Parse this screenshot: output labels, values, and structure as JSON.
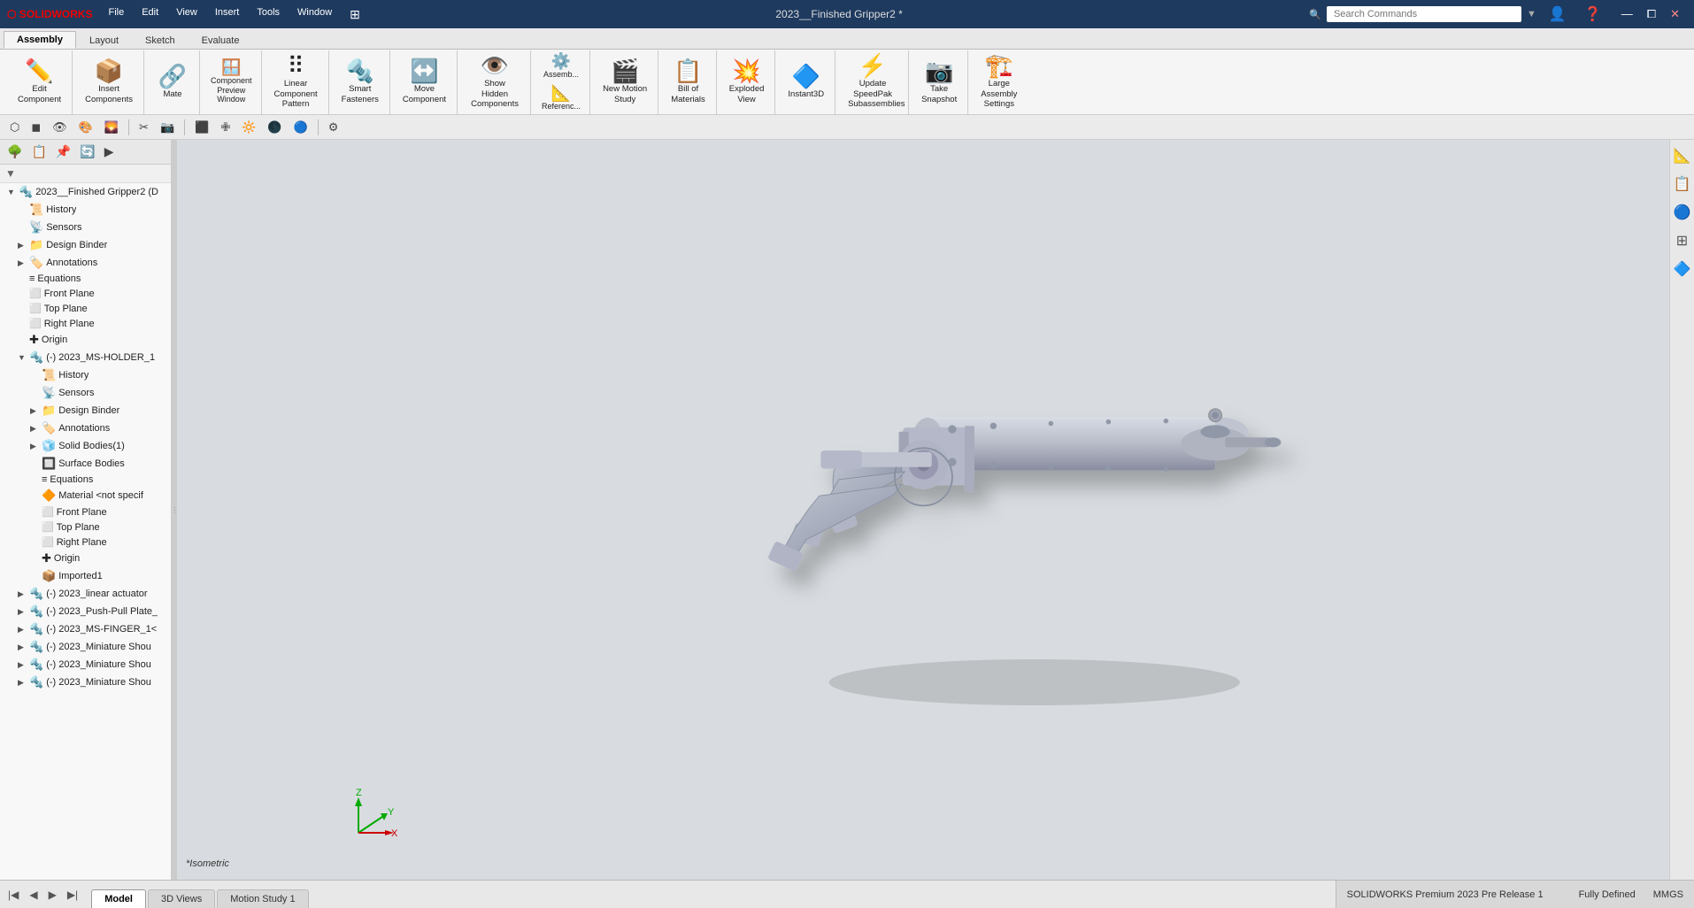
{
  "titlebar": {
    "logo": "SOLIDWORKS",
    "menus": [
      "File",
      "Edit",
      "View",
      "Insert",
      "Tools",
      "Window"
    ],
    "document_title": "2023__Finished Gripper2 *",
    "search_placeholder": "Search Commands",
    "win_buttons": [
      "—",
      "⧠",
      "✕"
    ]
  },
  "ribbon": {
    "tabs": [
      "Assembly",
      "Layout",
      "Sketch",
      "Evaluate"
    ],
    "active_tab": "Assembly",
    "buttons": [
      {
        "id": "edit-component",
        "icon": "✏️",
        "label": "Edit\nComponent",
        "large": true
      },
      {
        "id": "insert-components",
        "icon": "📦",
        "label": "Insert\nComponents",
        "large": true
      },
      {
        "id": "mate",
        "icon": "🔗",
        "label": "Mate",
        "large": true
      },
      {
        "id": "component-preview",
        "icon": "🪟",
        "label": "Component\nPreview\nWindow",
        "large": false
      },
      {
        "id": "linear-pattern",
        "icon": "⠿",
        "label": "Linear\nComponent\nPattern",
        "large": true
      },
      {
        "id": "smart-fasteners",
        "icon": "🔩",
        "label": "Smart\nFasteners",
        "large": true
      },
      {
        "id": "move-component",
        "icon": "↔️",
        "label": "Move\nComponent",
        "large": true
      },
      {
        "id": "show-hidden",
        "icon": "👁️",
        "label": "Show Hidden\nComponents",
        "large": true
      },
      {
        "id": "assembly-features",
        "icon": "⚙️",
        "label": "Assemb...",
        "large": true
      },
      {
        "id": "reference-geometry",
        "icon": "📐",
        "label": "Referenc...",
        "large": true
      },
      {
        "id": "new-motion-study",
        "icon": "🎬",
        "label": "New Motion\nStudy",
        "large": true
      },
      {
        "id": "bill-of-materials",
        "icon": "📋",
        "label": "Bill of\nMaterials",
        "large": true
      },
      {
        "id": "exploded-view",
        "icon": "💥",
        "label": "Exploded\nView",
        "large": true
      },
      {
        "id": "instant3d",
        "icon": "🔷",
        "label": "Instant3D",
        "large": true
      },
      {
        "id": "update-speedpak",
        "icon": "⚡",
        "label": "Update\nSpeedPak\nSubassemblies",
        "large": true
      },
      {
        "id": "take-snapshot",
        "icon": "📷",
        "label": "Take\nSnapshot",
        "large": true
      },
      {
        "id": "large-assembly",
        "icon": "🏗️",
        "label": "Large\nAssembly\nSettings",
        "large": true
      }
    ]
  },
  "view_toolbar": {
    "buttons": [
      "🔲",
      "📋",
      "🔳",
      "⬛",
      "🖨️",
      "↩️",
      "↪️",
      "→",
      "⬡",
      "▶",
      "🔵",
      "⚙️",
      "🔦"
    ]
  },
  "sidebar": {
    "toolbar_buttons": [
      "🌳",
      "📋",
      "📌",
      "🔄",
      "▶"
    ],
    "filter_icon": "▼",
    "tree": [
      {
        "level": 0,
        "icon": "🔩",
        "label": "2023__Finished Gripper2 (D",
        "expandable": true,
        "expanded": true,
        "type": "assembly"
      },
      {
        "level": 1,
        "icon": "📜",
        "label": "History",
        "expandable": false,
        "type": "feature"
      },
      {
        "level": 1,
        "icon": "📡",
        "label": "Sensors",
        "expandable": false,
        "type": "feature"
      },
      {
        "level": 1,
        "icon": "📁",
        "label": "Design Binder",
        "expandable": true,
        "type": "folder"
      },
      {
        "level": 1,
        "icon": "🏷️",
        "label": "Annotations",
        "expandable": true,
        "type": "folder"
      },
      {
        "level": 1,
        "icon": "≡",
        "label": "Equations",
        "expandable": false,
        "type": "feature"
      },
      {
        "level": 1,
        "icon": "⬛",
        "label": "Front Plane",
        "expandable": false,
        "type": "plane"
      },
      {
        "level": 1,
        "icon": "⬛",
        "label": "Top Plane",
        "expandable": false,
        "type": "plane"
      },
      {
        "level": 1,
        "icon": "⬛",
        "label": "Right Plane",
        "expandable": false,
        "type": "plane"
      },
      {
        "level": 1,
        "icon": "✚",
        "label": "Origin",
        "expandable": false,
        "type": "origin"
      },
      {
        "level": 1,
        "icon": "🔩",
        "label": "(-) 2023_MS-HOLDER_1",
        "expandable": true,
        "expanded": true,
        "type": "component"
      },
      {
        "level": 2,
        "icon": "📜",
        "label": "History",
        "expandable": false,
        "type": "feature"
      },
      {
        "level": 2,
        "icon": "📡",
        "label": "Sensors",
        "expandable": false,
        "type": "feature"
      },
      {
        "level": 2,
        "icon": "📁",
        "label": "Design Binder",
        "expandable": true,
        "type": "folder"
      },
      {
        "level": 2,
        "icon": "🏷️",
        "label": "Annotations",
        "expandable": true,
        "type": "folder"
      },
      {
        "level": 2,
        "icon": "🧊",
        "label": "Solid Bodies(1)",
        "expandable": true,
        "type": "folder"
      },
      {
        "level": 2,
        "icon": "🔲",
        "label": "Surface Bodies",
        "expandable": false,
        "type": "folder"
      },
      {
        "level": 2,
        "icon": "≡",
        "label": "Equations",
        "expandable": false,
        "type": "feature"
      },
      {
        "level": 2,
        "icon": "🔶",
        "label": "Material <not specif",
        "expandable": false,
        "type": "material"
      },
      {
        "level": 2,
        "icon": "⬛",
        "label": "Front Plane",
        "expandable": false,
        "type": "plane"
      },
      {
        "level": 2,
        "icon": "⬛",
        "label": "Top Plane",
        "expandable": false,
        "type": "plane"
      },
      {
        "level": 2,
        "icon": "⬛",
        "label": "Right Plane",
        "expandable": false,
        "type": "plane"
      },
      {
        "level": 2,
        "icon": "✚",
        "label": "Origin",
        "expandable": false,
        "type": "origin"
      },
      {
        "level": 2,
        "icon": "📦",
        "label": "Imported1",
        "expandable": false,
        "type": "import"
      },
      {
        "level": 1,
        "icon": "🔩",
        "label": "(-) 2023_linear actuator",
        "expandable": true,
        "type": "component"
      },
      {
        "level": 1,
        "icon": "🔩",
        "label": "(-) 2023_Push-Pull Plate_",
        "expandable": true,
        "type": "component"
      },
      {
        "level": 1,
        "icon": "🔩",
        "label": "(-) 2023_MS-FINGER_1<",
        "expandable": true,
        "type": "component"
      },
      {
        "level": 1,
        "icon": "🔩",
        "label": "(-) 2023_Miniature Shou",
        "expandable": true,
        "type": "component"
      },
      {
        "level": 1,
        "icon": "🔩",
        "label": "(-) 2023_Miniature Shou",
        "expandable": true,
        "type": "component"
      },
      {
        "level": 1,
        "icon": "🔩",
        "label": "(-) 2023_Miniature Shou",
        "expandable": true,
        "type": "component"
      }
    ]
  },
  "viewport": {
    "isometric_label": "*Isometric",
    "background_color": "#d4d8de"
  },
  "right_panel": {
    "buttons": [
      "📐",
      "📋",
      "🔵",
      "⊞",
      "🔷"
    ]
  },
  "bottom_tabs": [
    "Model",
    "3D Views",
    "Motion Study 1"
  ],
  "active_bottom_tab": "Model",
  "status": {
    "fully_defined": "Fully Defined",
    "units": "MMGS"
  }
}
